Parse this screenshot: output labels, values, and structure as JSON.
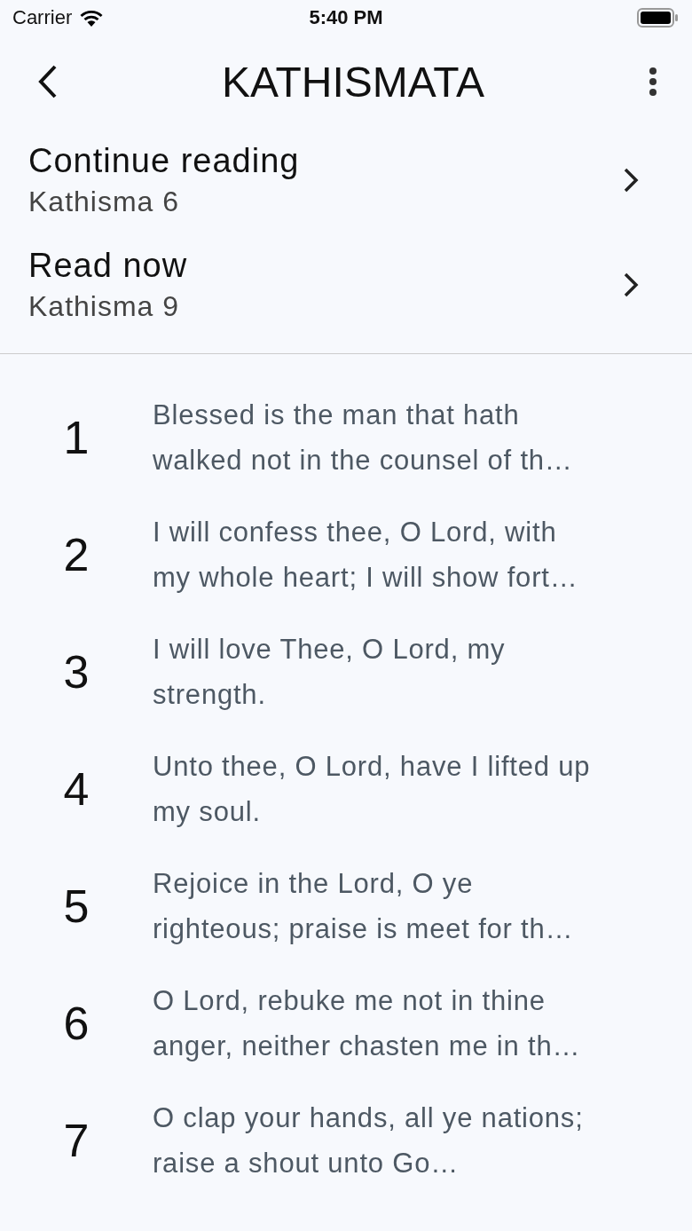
{
  "status_bar": {
    "carrier": "Carrier",
    "time": "5:40 PM"
  },
  "header": {
    "title": "KATHISMATA"
  },
  "links": [
    {
      "title": "Continue reading",
      "subtitle": "Kathisma 6"
    },
    {
      "title": "Read now",
      "subtitle": "Kathisma 9"
    }
  ],
  "psalms": [
    {
      "number": "1",
      "text": "Blessed is the man that hath walked not in the counsel of th…"
    },
    {
      "number": "2",
      "text": "I will confess thee, O Lord, with my whole heart; I will show fort…"
    },
    {
      "number": "3",
      "text": "I will love Thee, O Lord, my strength."
    },
    {
      "number": "4",
      "text": "Unto thee, O Lord, have I lifted up my soul."
    },
    {
      "number": "5",
      "text": "Rejoice in the Lord, O ye righteous; praise is meet for th…"
    },
    {
      "number": "6",
      "text": "O Lord, rebuke me not in thine anger, neither chasten me in th…"
    },
    {
      "number": "7",
      "text": "O clap your hands, all ye nations; raise a shout unto Go…"
    }
  ]
}
